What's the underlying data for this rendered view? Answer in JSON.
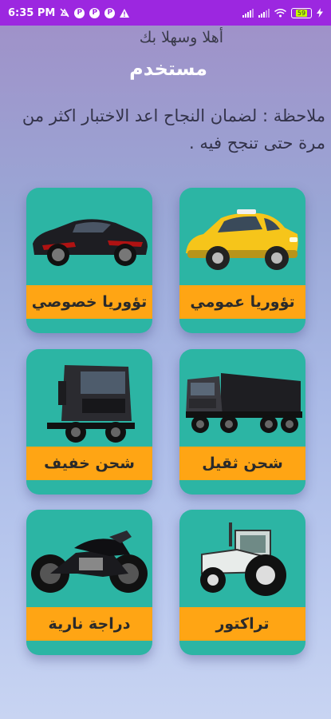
{
  "status_bar": {
    "time": "6:35 PM",
    "icons_left": [
      "mute-icon",
      "p-icon",
      "p-icon",
      "p-icon",
      "warning-icon"
    ],
    "battery": "59"
  },
  "header": {
    "greeting": "أهلا وسهلا بك",
    "username": "مستخدم"
  },
  "note": "ملاحظة : لضمان النجاح اعد الاختبار اكثر من مرة حتى تنجح فيه .",
  "categories": [
    {
      "label": "تؤوريا عمومي",
      "icon": "taxi"
    },
    {
      "label": "تؤوريا خصوصي",
      "icon": "sports-car"
    },
    {
      "label": "شحن ثقيل",
      "icon": "dump-truck"
    },
    {
      "label": "شحن خفيف",
      "icon": "truck-cab"
    },
    {
      "label": "تراكتور",
      "icon": "tractor"
    },
    {
      "label": "دراجة نارية",
      "icon": "motorcycle"
    }
  ],
  "colors": {
    "status_bar": "#9c27e0",
    "card": "#2cb5a4",
    "label_bar": "#ffa514"
  }
}
